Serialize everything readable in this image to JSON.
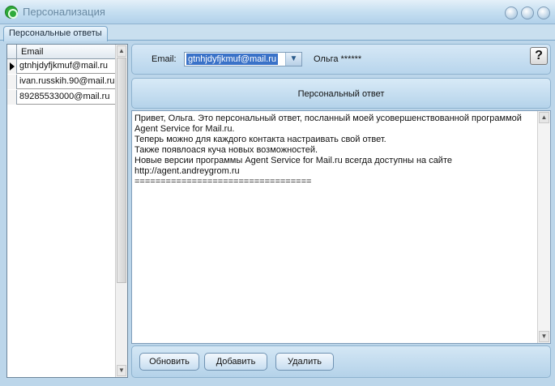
{
  "window": {
    "title": "Персонализация"
  },
  "tabs": [
    {
      "label": "Персональные ответы"
    }
  ],
  "list": {
    "column_header": "Email",
    "rows": [
      {
        "email": "gtnhjdyfjkmuf@mail.ru",
        "current": true
      },
      {
        "email": "ivan.russkih.90@mail.ru",
        "current": false
      },
      {
        "email": "89285533000@mail.ru",
        "current": false
      }
    ]
  },
  "top": {
    "email_label": "Email:",
    "email_value": "gtnhjdyfjkmuf@mail.ru",
    "contact_name": "Ольга ******",
    "help_label": "?"
  },
  "section": {
    "title": "Персональный ответ"
  },
  "message": {
    "lines": [
      "Привет, Ольга. Это персональный ответ, посланный моей усовершенствованной программой",
      "Agent Service for Mail.ru.",
      "Теперь можно для каждого контакта настраивать свой ответ.",
      "Также появлоася куча новых возможностей.",
      "Новые версии программы Agent Service for Mail.ru всегда доступны на сайте",
      "http://agent.andreygrom.ru",
      "=================================="
    ]
  },
  "buttons": {
    "refresh": "Обновить",
    "add": "Добавить",
    "delete": "Удалить"
  },
  "colors": {
    "accent": "#3a72c8",
    "panel": "#bcd6ea",
    "app_icon": "#2eaa3a"
  }
}
